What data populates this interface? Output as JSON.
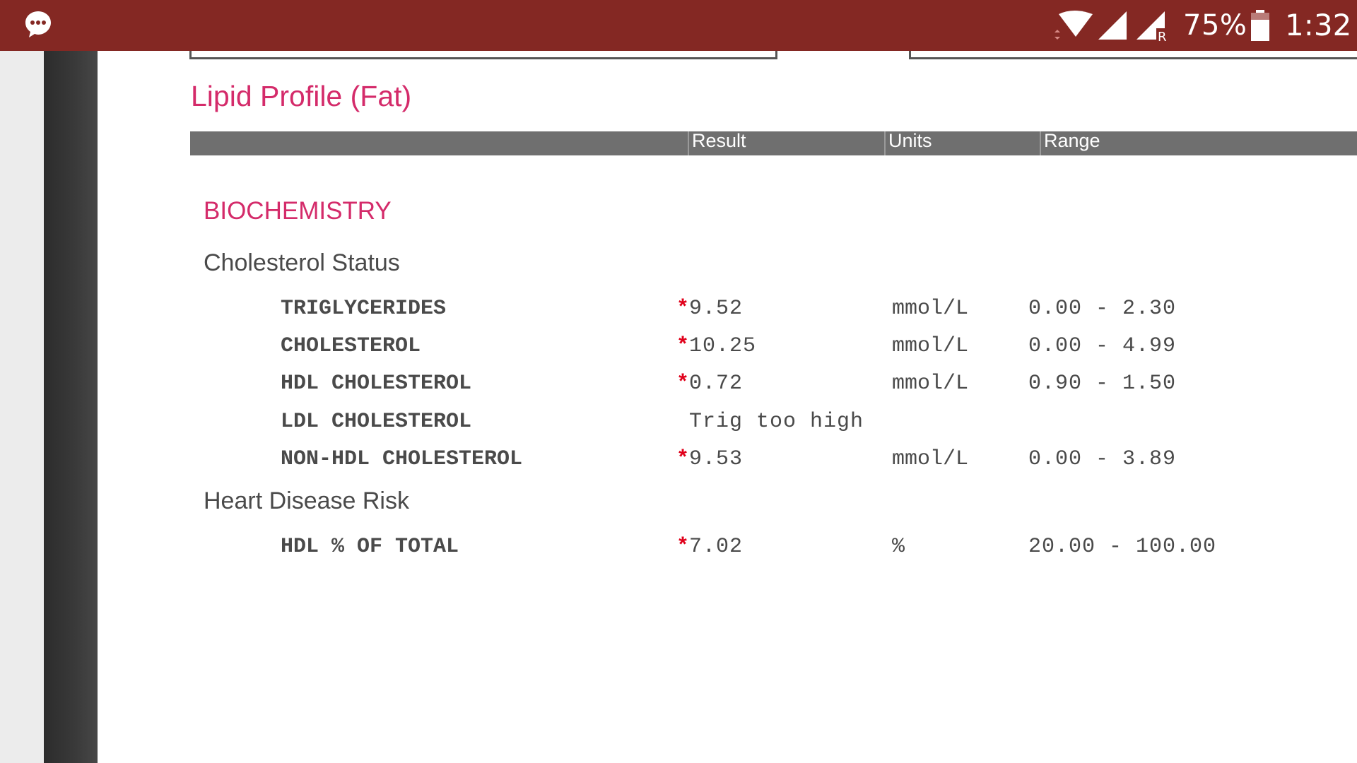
{
  "status_bar": {
    "battery_percent": "75%",
    "time": "1:32",
    "icons": [
      "chat-bubble-icon",
      "wifi-icon",
      "signal-icon",
      "signal-roaming-icon",
      "battery-icon"
    ],
    "roaming_label": "R",
    "background_color": "#842823"
  },
  "report": {
    "title": "Lipid Profile (Fat)",
    "columns": {
      "result": "Result",
      "units": "Units",
      "range": "Range"
    },
    "section": "BIOCHEMISTRY",
    "groups": [
      {
        "title": "Cholesterol Status",
        "tests": [
          {
            "name": "TRIGLYCERIDES",
            "flag": "*",
            "result": "9.52",
            "units": "mmol/L",
            "range": "0.00 - 2.30"
          },
          {
            "name": "CHOLESTEROL",
            "flag": "*",
            "result": "10.25",
            "units": "mmol/L",
            "range": "0.00 - 4.99"
          },
          {
            "name": "HDL CHOLESTEROL",
            "flag": "*",
            "result": "0.72",
            "units": "mmol/L",
            "range": "0.90 - 1.50"
          },
          {
            "name": "LDL CHOLESTEROL",
            "flag": "",
            "result": "Trig too high",
            "units": "",
            "range": ""
          },
          {
            "name": "NON-HDL CHOLESTEROL",
            "flag": "*",
            "result": "9.53",
            "units": "mmol/L",
            "range": "0.00 - 3.89"
          }
        ]
      },
      {
        "title": "Heart Disease Risk",
        "tests": [
          {
            "name": "HDL % OF TOTAL",
            "flag": "*",
            "result": "7.02",
            "units": "%",
            "range": "20.00 - 100.00"
          }
        ]
      }
    ],
    "colors": {
      "title": "#d42b6a",
      "flag": "#e0001a",
      "header_bar": "#6f6f6f"
    }
  }
}
